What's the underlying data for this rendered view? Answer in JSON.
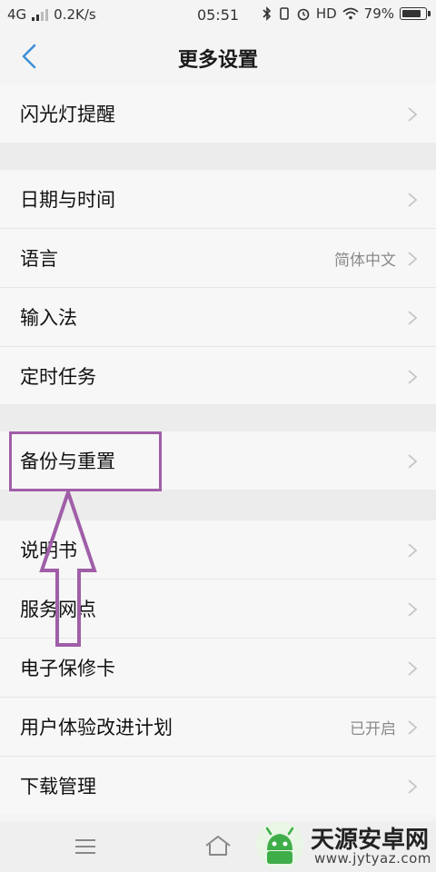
{
  "status_bar": {
    "network": "4G",
    "speed": "0.2K/s",
    "time": "05:51",
    "hd": "HD",
    "battery": "79%"
  },
  "header": {
    "title": "更多设置"
  },
  "groups": [
    {
      "items": [
        {
          "label": "闪光灯提醒",
          "value": ""
        }
      ]
    },
    {
      "items": [
        {
          "label": "日期与时间",
          "value": ""
        },
        {
          "label": "语言",
          "value": "简体中文"
        },
        {
          "label": "输入法",
          "value": ""
        },
        {
          "label": "定时任务",
          "value": ""
        }
      ]
    },
    {
      "items": [
        {
          "label": "备份与重置",
          "value": ""
        }
      ]
    },
    {
      "items": [
        {
          "label": "说明书",
          "value": ""
        },
        {
          "label": "服务网点",
          "value": ""
        },
        {
          "label": "电子保修卡",
          "value": ""
        },
        {
          "label": "用户体验改进计划",
          "value": "已开启"
        },
        {
          "label": "下载管理",
          "value": ""
        }
      ]
    }
  ],
  "watermark": {
    "title": "天源安卓网",
    "url": "www.jytyaz.com"
  },
  "colors": {
    "accent": "#3c8fd8",
    "annotation": "#a05ea8",
    "logo_green": "#3fae49"
  }
}
